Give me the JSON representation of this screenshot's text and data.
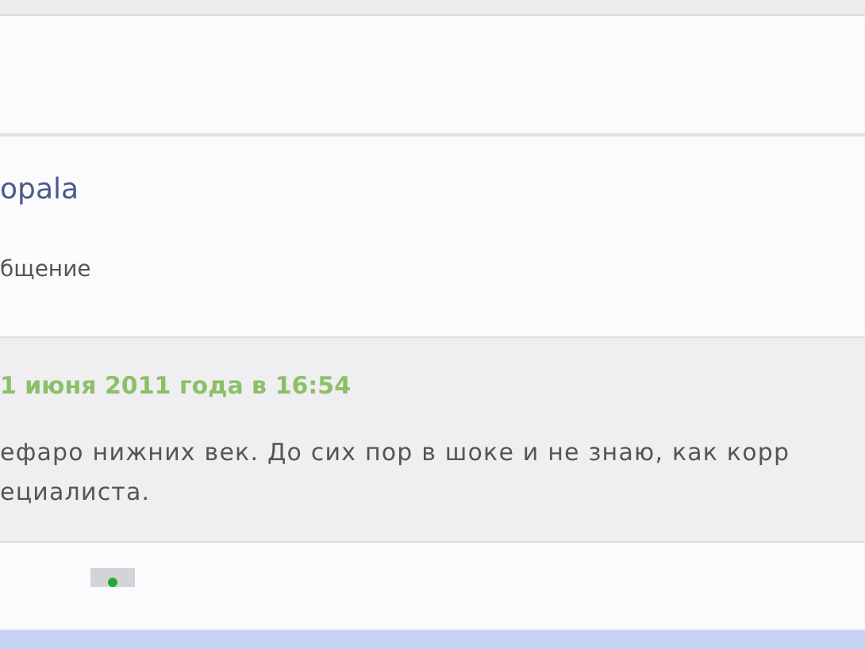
{
  "author": {
    "name": "opala"
  },
  "subtitle": "бщение",
  "post": {
    "date": "1 июня 2011 года в 16:54",
    "text": "ефаро нижних век. До сих пор в шоке и не знаю, как корр\nециалиста."
  }
}
